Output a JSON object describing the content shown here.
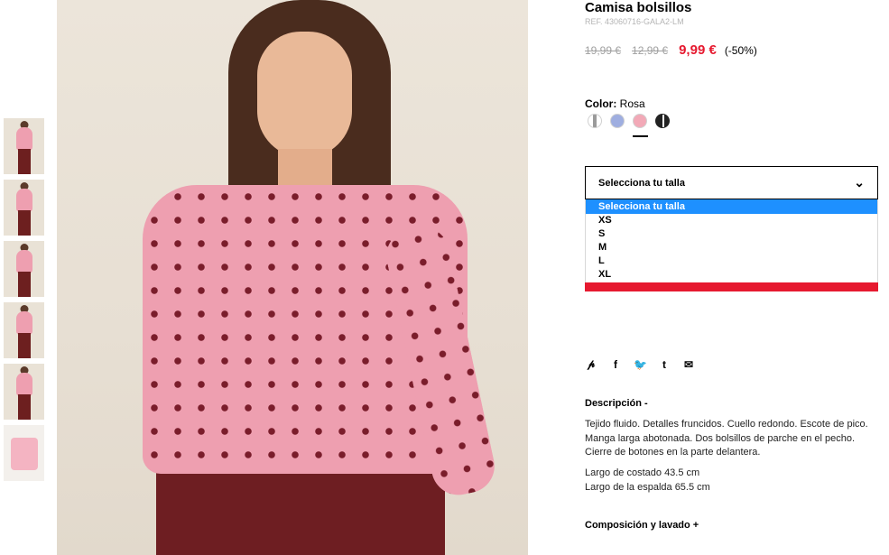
{
  "product": {
    "title": "Camisa bolsillos",
    "ref": "REF. 43060716-GALA2-LM",
    "price_original": "19,99 €",
    "price_previous": "12,99 €",
    "price_current": "9,99 €",
    "discount": "(-50%)"
  },
  "color": {
    "label": "Color:",
    "selected": "Rosa",
    "swatches": [
      {
        "name": "stripe-grey",
        "color": "#b9b9b9"
      },
      {
        "name": "blue",
        "color": "#9faee0"
      },
      {
        "name": "pink",
        "color": "#f2a9b7"
      },
      {
        "name": "black-white",
        "color": "#222222"
      }
    ]
  },
  "size": {
    "select_label": "Selecciona tu talla",
    "options": [
      "Selecciona tu talla",
      "XS",
      "S",
      "M",
      "L",
      "XL"
    ]
  },
  "social": {
    "icons": [
      "pinterest-icon",
      "facebook-icon",
      "twitter-icon",
      "tumblr-icon",
      "email-icon"
    ],
    "glyphs": [
      "℗",
      "f",
      "🐦",
      "t",
      "✉"
    ]
  },
  "description": {
    "heading": "Descripción -",
    "text": "Tejido fluido. Detalles fruncidos. Cuello redondo. Escote de pico. Manga larga abotonada. Dos bolsillos de parche en el pecho. Cierre de botones en la parte delantera.",
    "measure1": "Largo de costado 43.5 cm",
    "measure2": "Largo de la espalda 65.5 cm"
  },
  "composition": {
    "heading": "Composición y lavado +"
  },
  "colors": {
    "accent_red": "#e6192f",
    "highlight_blue": "#1e90ff"
  }
}
